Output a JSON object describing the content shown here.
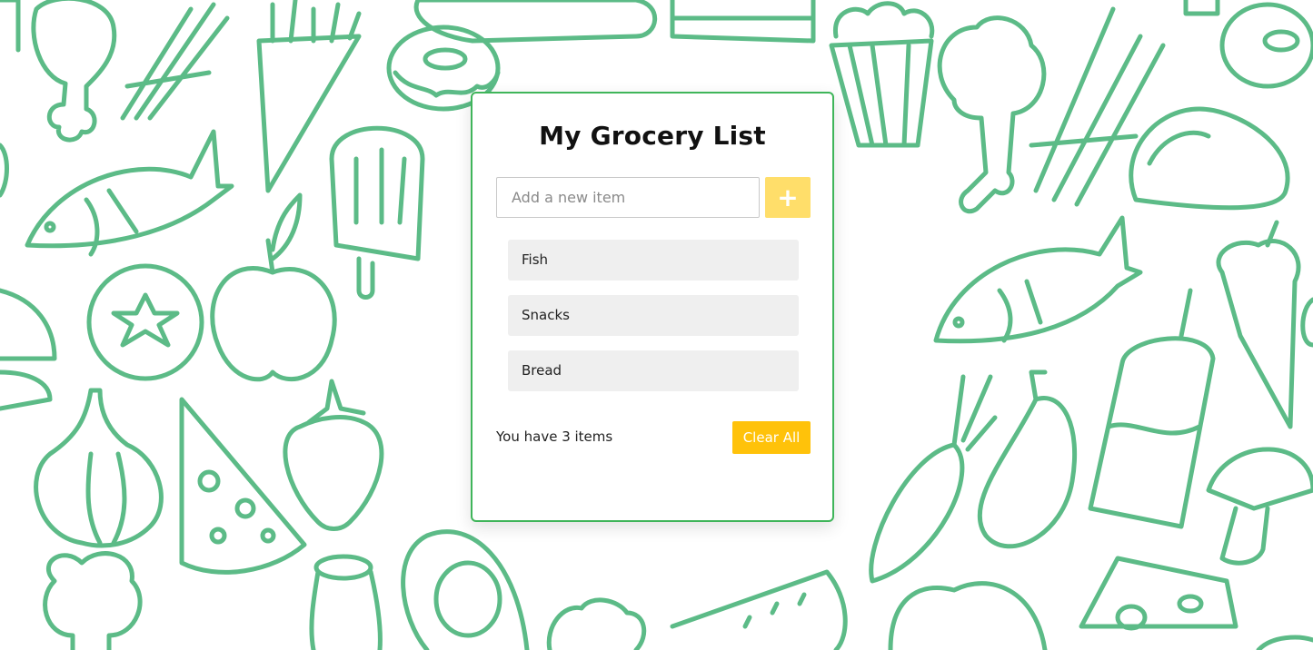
{
  "app": {
    "title": "My Grocery List"
  },
  "add_item": {
    "placeholder": "Add a new item",
    "value": "",
    "button_label": "+"
  },
  "items": [
    {
      "label": "Fish"
    },
    {
      "label": "Snacks"
    },
    {
      "label": "Bread"
    }
  ],
  "footer": {
    "count_text": "You have 3 items",
    "clear_label": "Clear All"
  },
  "colors": {
    "accent_button": "#ffc20a",
    "add_button": "#ffde6a",
    "card_border": "#3fb55a",
    "doodle_stroke": "#5cbb87"
  },
  "background": {
    "pattern_icons": [
      "fish-icon",
      "apple-icon",
      "tomato-icon",
      "donut-icon",
      "fries-icon",
      "popsicle-icon",
      "popcorn-icon",
      "broccoli-icon",
      "taco-icon",
      "carrot-icon",
      "eggplant-icon",
      "smoothie-icon",
      "ice-cream-icon",
      "garlic-icon",
      "pizza-slice-icon",
      "strawberry-icon",
      "avocado-icon",
      "watermelon-icon",
      "cheese-icon",
      "mushroom-icon",
      "burger-icon",
      "drumstick-icon",
      "asparagus-icon",
      "milk-bottle-icon",
      "bread-icon"
    ]
  }
}
